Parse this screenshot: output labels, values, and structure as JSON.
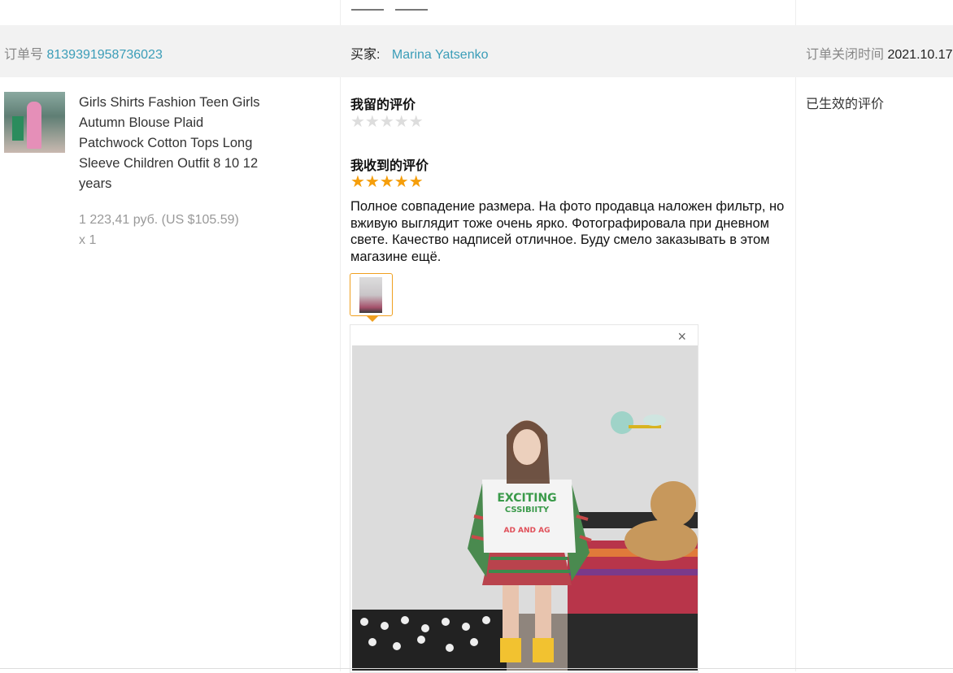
{
  "order": {
    "number_label": "订单号",
    "number": "8139391958736023",
    "buyer_label": "买家:",
    "buyer": "Marina Yatsenko",
    "closed_label": "订单关闭时间",
    "closed_time": "2021.10.17"
  },
  "product": {
    "title": "Girls Shirts Fashion Teen Girls Autumn Blouse Plaid Patchwock Cotton Tops Long Sleeve Children Outfit 8 10 12 years",
    "price": "1 223,41 руб. (US $105.59)",
    "quantity": "x 1"
  },
  "my_review": {
    "title": "我留的评价",
    "stars": 0,
    "max_stars": 5
  },
  "received_review": {
    "title": "我收到的评价",
    "stars": 5,
    "max_stars": 5,
    "text": "Полное совпадение размера. На фото продавца наложен фильтр, но вживую выглядит тоже очень ярко. Фотографировала при дневном свете. Качество надписей отличное. Буду смело заказывать в этом магазине ещё."
  },
  "preview": {
    "close_symbol": "×",
    "shirt_text_1": "EXCITING",
    "shirt_text_2": "CSSIBIITY",
    "shirt_text_3": "AD AND AG"
  },
  "effective_review": {
    "title": "已生效的评价"
  },
  "colors": {
    "link": "#3b9db8",
    "star_full": "#f59e0b",
    "star_empty": "#dddddd",
    "accent_border": "#f0a020"
  }
}
